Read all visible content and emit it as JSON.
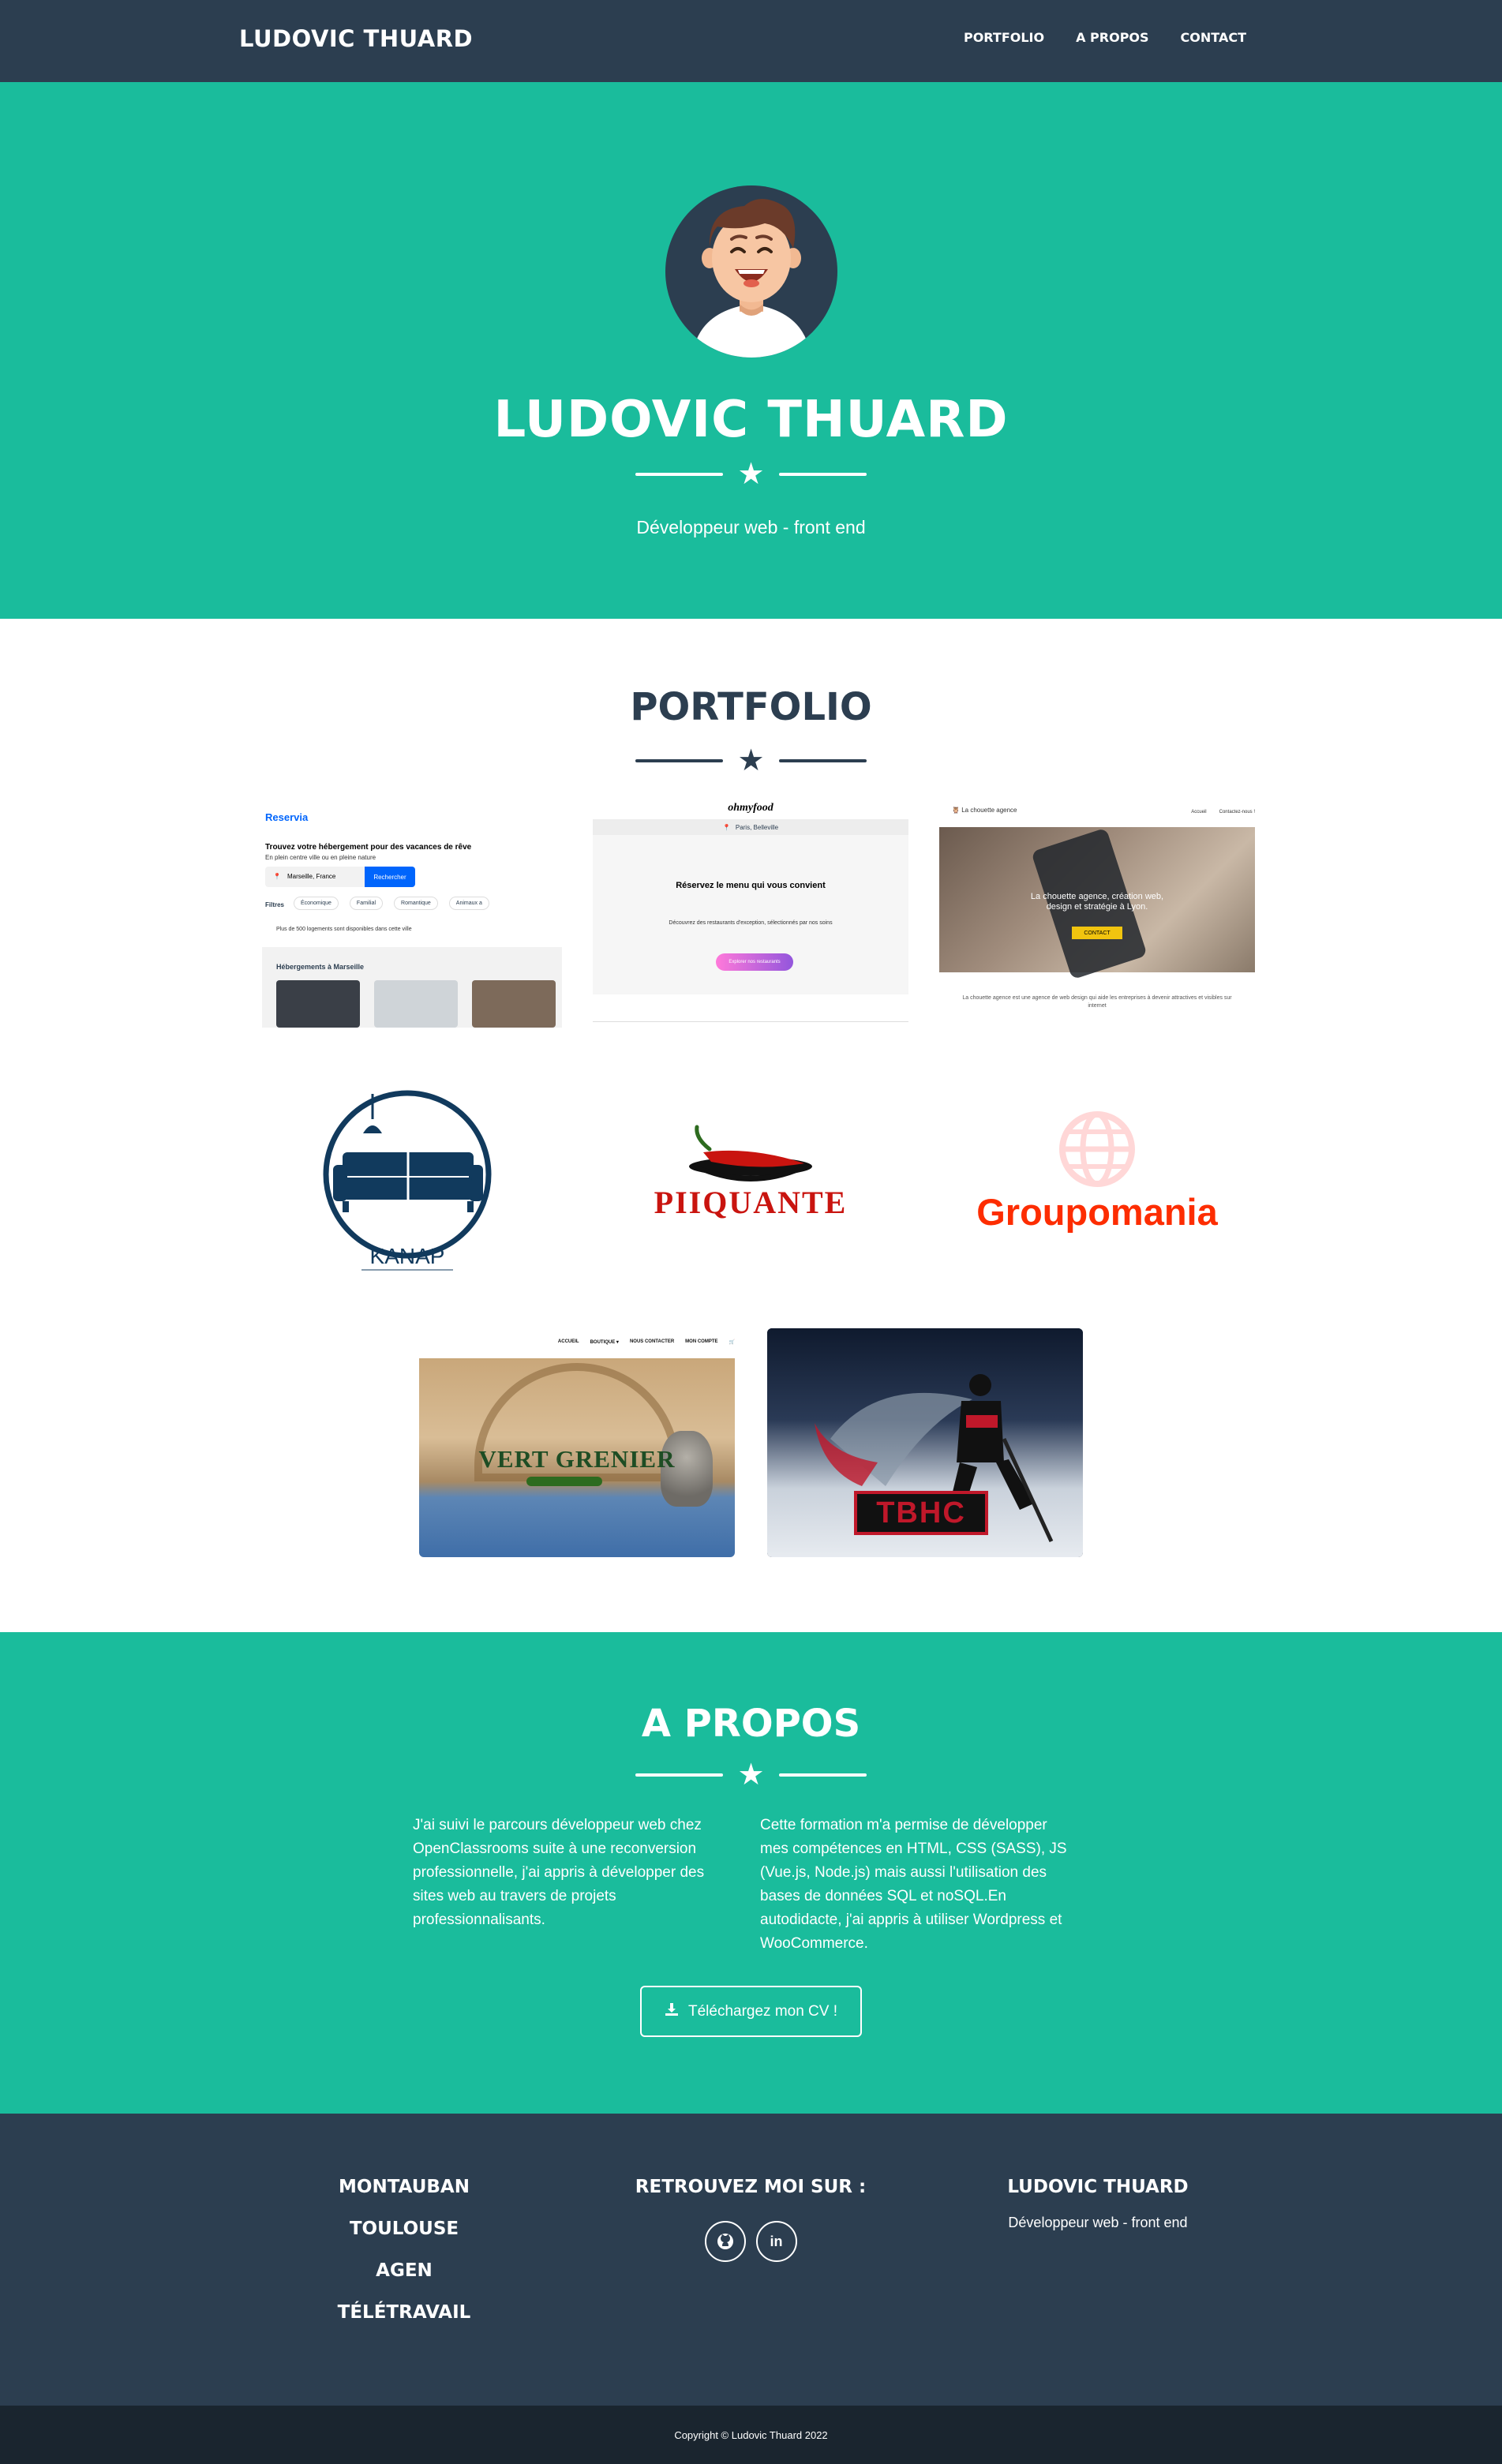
{
  "nav": {
    "brand": "LUDOVIC THUARD",
    "links": [
      "PORTFOLIO",
      "A PROPOS",
      "CONTACT"
    ]
  },
  "hero": {
    "title": "LUDOVIC THUARD",
    "subtitle": "Développeur web - front end",
    "divider_icon": "star-icon"
  },
  "portfolio": {
    "title": "PORTFOLIO",
    "projects": [
      {
        "name": "reservia",
        "logo": "Reservia",
        "headline": "Trouvez votre hébergement pour des vacances de rêve",
        "sub": "En plein centre ville ou en pleine nature",
        "city": "Marseille, France",
        "button": "Rechercher",
        "filters_label": "Filtres",
        "filters": [
          "Économique",
          "Familial",
          "Romantique",
          "Animaux a"
        ],
        "notice": "Plus de 500 logements sont disponibles dans cette ville",
        "section": "Hébergements à Marseille"
      },
      {
        "name": "ohmyfood",
        "logo": "ohmyfood",
        "location": "Paris, Belleville",
        "headline": "Réservez le menu qui vous convient",
        "text": "Découvrez des restaurants d'exception, sélectionnés par nos soins",
        "button": "Explorer nos restaurants"
      },
      {
        "name": "la-chouette-agence",
        "logo": "La chouette agence",
        "nav": [
          "Accueil",
          "Contactez-nous !"
        ],
        "headline": "La chouette agence, création web, design et stratégie à Lyon.",
        "button": "CONTACT",
        "text": "La chouette agence est une agence de web design qui aide les entreprises à devenir attractives et visibles sur internet"
      },
      {
        "name": "kanap",
        "logo": "KANAP"
      },
      {
        "name": "piiquante",
        "logo": "PIIQUANTE"
      },
      {
        "name": "groupomania",
        "logo": "Groupomania"
      },
      {
        "name": "vert-grenier",
        "logo": "VERT GRENIER",
        "menu": [
          "ACCUEIL",
          "BOUTIQUE ▾",
          "NOUS CONTACTER",
          "MON COMPTE"
        ]
      },
      {
        "name": "tbhc",
        "logo": "TBHC"
      }
    ]
  },
  "about": {
    "title": "A PROPOS",
    "col1": "J'ai suivi le parcours développeur web chez OpenClassrooms suite à une reconversion professionnelle, j'ai appris à développer des sites web au travers de projets professionnalisants.",
    "col2": "Cette formation m'a permise de développer mes compétences en HTML, CSS (SASS), JS (Vue.js, Node.js) mais aussi l'utilisation des bases de données SQL et noSQL.En autodidacte, j'ai appris à utiliser Wordpress et WooCommerce.",
    "cv_button": "Téléchargez mon CV !"
  },
  "footer": {
    "cities": [
      "MONTAUBAN",
      "TOULOUSE",
      "AGEN",
      "TÉLÉTRAVAIL"
    ],
    "social_title": "RETROUVEZ MOI SUR :",
    "social": [
      {
        "icon": "github-icon"
      },
      {
        "icon": "linkedin-icon",
        "label": "in"
      }
    ],
    "name": "LUDOVIC THUARD",
    "role": "Développeur web - front end",
    "copyright": "Copyright © Ludovic Thuard 2022"
  },
  "colors": {
    "primary": "#1abc9c",
    "dark": "#2c3e50",
    "darker": "#1a252f"
  }
}
